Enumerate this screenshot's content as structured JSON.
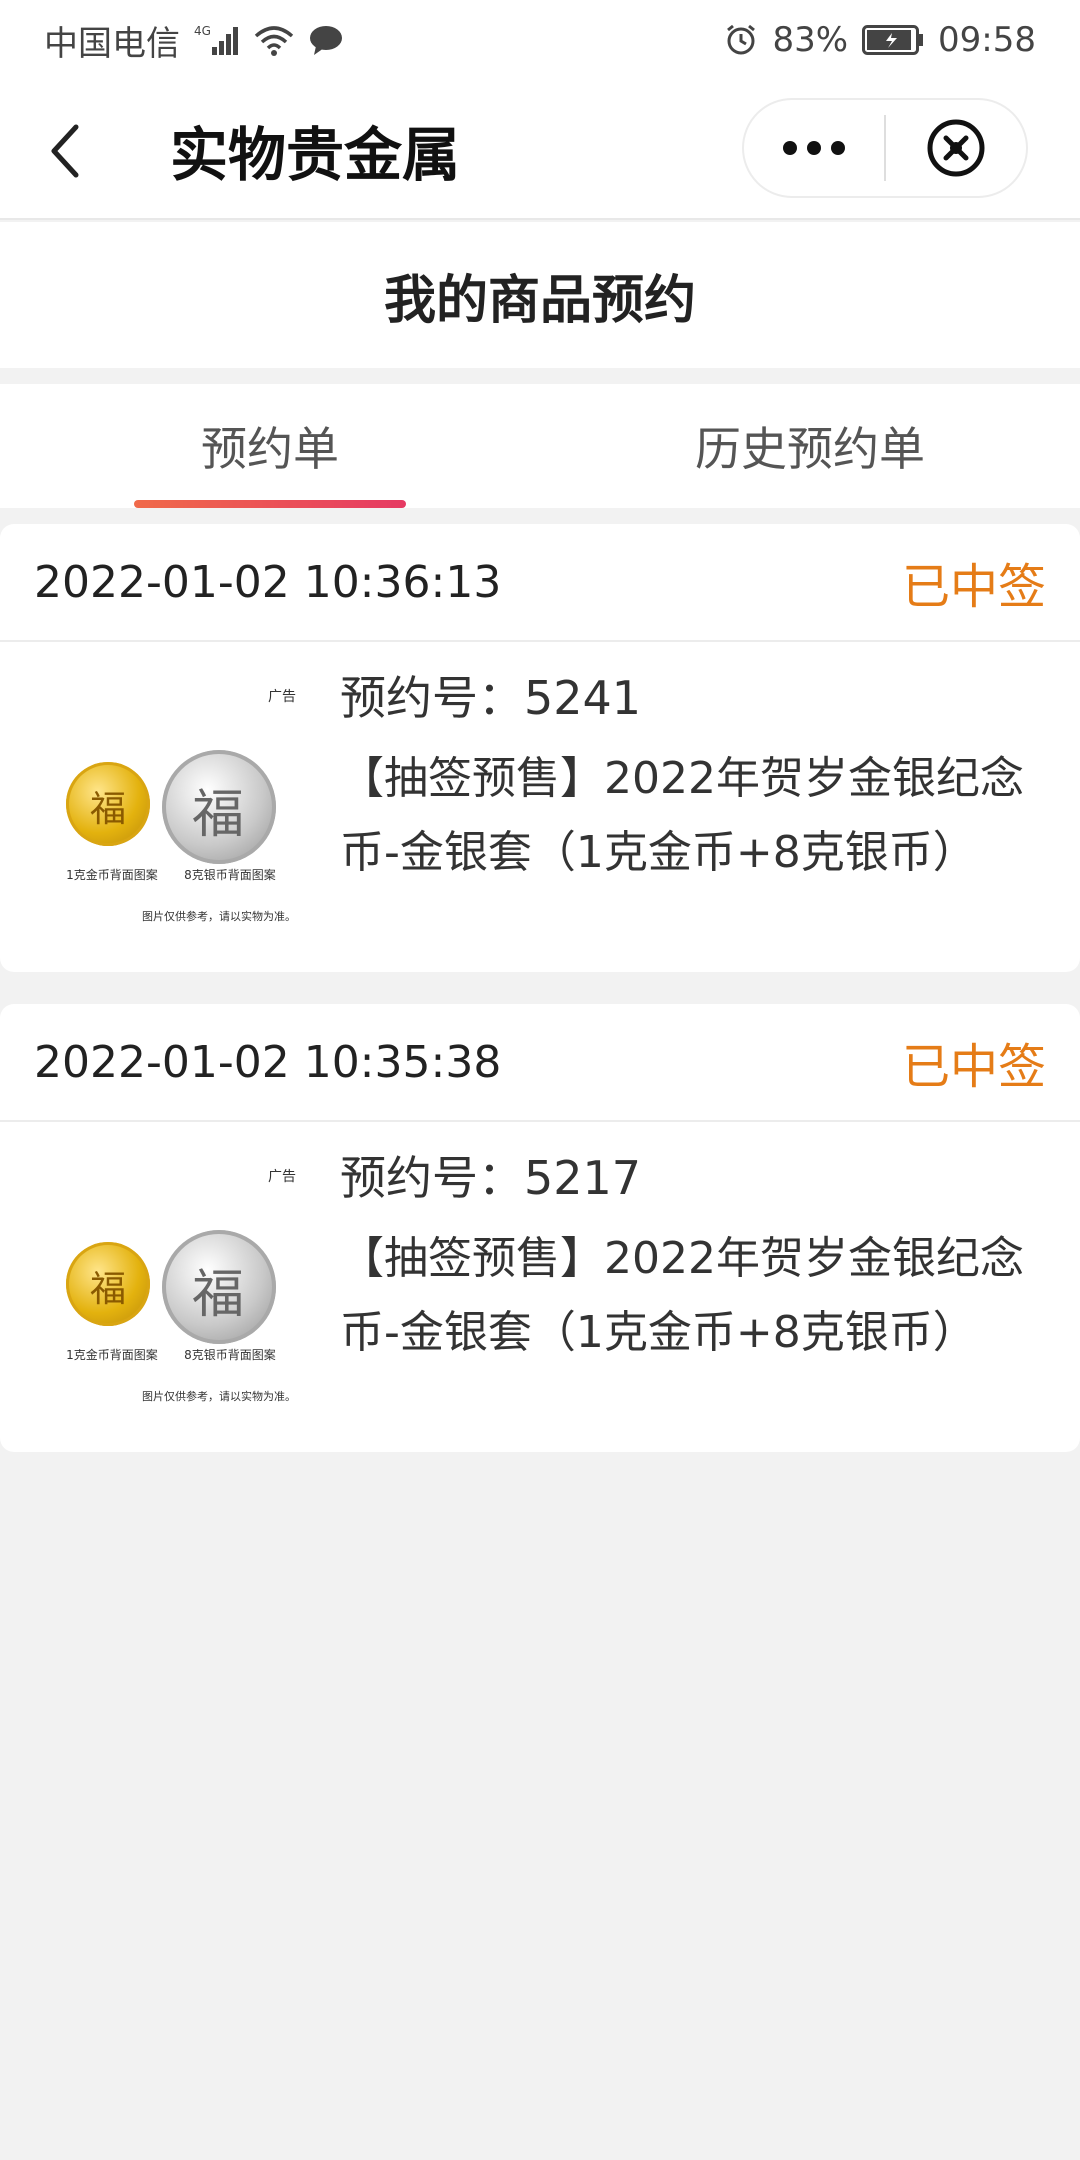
{
  "status_bar": {
    "carrier": "中国电信",
    "network": "4G",
    "battery": "83%",
    "time": "09:58"
  },
  "navbar": {
    "title": "实物贵金属"
  },
  "page": {
    "title": "我的商品预约"
  },
  "tabs": [
    {
      "label": "预约单",
      "active": true
    },
    {
      "label": "历史预约单",
      "active": false
    }
  ],
  "orders": [
    {
      "time": "2022-01-02 10:36:13",
      "status": "已中签",
      "reservation_label": "预约号：",
      "reservation_no": "5241",
      "product_name": "【抽签预售】2022年贺岁金银纪念币-金银套（1克金币+8克银币）",
      "image": {
        "ad_tag": "广告",
        "gold_caption": "1克金币背面图案",
        "silver_caption": "8克银币背面图案",
        "note": "图片仅供参考，请以实物为准。"
      }
    },
    {
      "time": "2022-01-02 10:35:38",
      "status": "已中签",
      "reservation_label": "预约号：",
      "reservation_no": "5217",
      "product_name": "【抽签预售】2022年贺岁金银纪念币-金银套（1克金币+8克银币）",
      "image": {
        "ad_tag": "广告",
        "gold_caption": "1克金币背面图案",
        "silver_caption": "8克银币背面图案",
        "note": "图片仅供参考，请以实物为准。"
      }
    }
  ],
  "colors": {
    "status": "#e57c17",
    "tab_underline_start": "#f06a4a",
    "tab_underline_end": "#e63a63"
  }
}
